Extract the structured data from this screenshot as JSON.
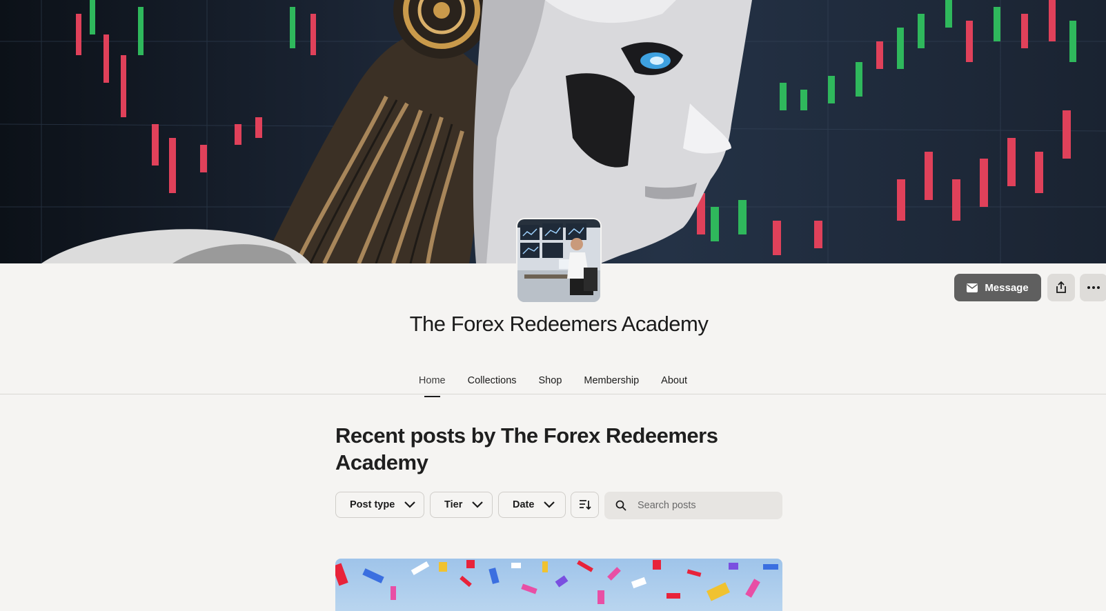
{
  "creator": {
    "name": "The Forex Redeemers Academy"
  },
  "actions": {
    "message_label": "Message"
  },
  "tabs": [
    {
      "label": "Home",
      "active": true
    },
    {
      "label": "Collections"
    },
    {
      "label": "Shop"
    },
    {
      "label": "Membership"
    },
    {
      "label": "About"
    }
  ],
  "posts": {
    "heading": "Recent posts by The Forex Redeemers Academy",
    "filters": {
      "post_type": "Post type",
      "tier": "Tier",
      "date": "Date"
    },
    "search_placeholder": "Search posts"
  },
  "icons": {
    "message": "envelope-icon",
    "share": "share-icon",
    "more": "more-horizontal-icon",
    "sort": "sort-icon",
    "search": "search-icon",
    "chevron": "chevron-down-icon"
  }
}
